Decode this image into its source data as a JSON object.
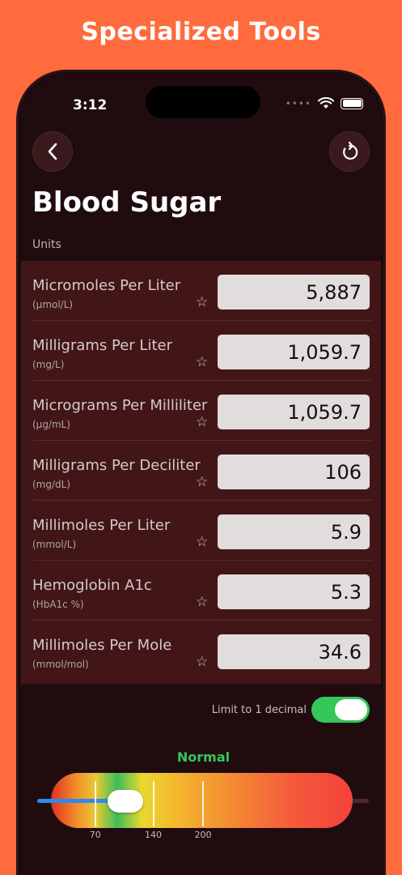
{
  "banner": {
    "title": "Specialized Tools"
  },
  "status_bar": {
    "time": "3:12",
    "signal_icon": "cellular-dots-icon",
    "wifi_icon": "wifi-icon",
    "battery_icon": "battery-icon"
  },
  "nav": {
    "back_icon": "chevron-left-icon",
    "reset_icon": "reset-arrow-icon"
  },
  "page": {
    "title": "Blood Sugar",
    "section_label": "Units"
  },
  "units": [
    {
      "name": "Micromoles Per Liter",
      "abbr": "(µmol/L)",
      "value": "5,887"
    },
    {
      "name": "Milligrams Per Liter",
      "abbr": "(mg/L)",
      "value": "1,059.7"
    },
    {
      "name": "Micrograms Per Milliliter",
      "abbr": "(µg/mL)",
      "value": "1,059.7"
    },
    {
      "name": "Milligrams Per Deciliter",
      "abbr": "(mg/dL)",
      "value": "106"
    },
    {
      "name": "Millimoles Per Liter",
      "abbr": "(mmol/L)",
      "value": "5.9"
    },
    {
      "name": "Hemoglobin A1c",
      "abbr": "(HbA1c %)",
      "value": "5.3"
    },
    {
      "name": "Millimoles Per Mole",
      "abbr": "(mmol/mol)",
      "value": "34.6"
    }
  ],
  "options": {
    "limit_label": "Limit to 1 decimal",
    "limit_on": true
  },
  "gauge": {
    "status": "Normal",
    "status_color": "#34C759",
    "min": 0,
    "max": 400,
    "value": 106,
    "ticks": [
      {
        "label": "70",
        "value": 70
      },
      {
        "label": "140",
        "value": 140
      },
      {
        "label": "200",
        "value": 200
      }
    ]
  },
  "colors": {
    "accent_orange": "#FF6B3D",
    "toggle_green": "#34C759",
    "slider_blue": "#2C8BF0"
  }
}
